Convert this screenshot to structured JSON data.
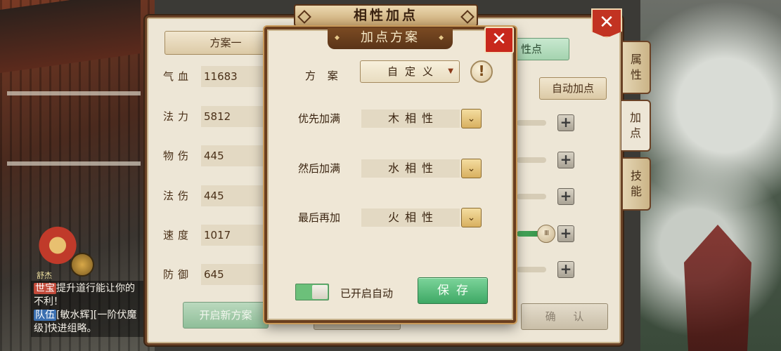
{
  "window": {
    "title": "相性加点",
    "close_label": "✕"
  },
  "left_panel": {
    "scheme_button": "方案一",
    "stats": [
      {
        "label": "气血",
        "value": "11683"
      },
      {
        "label": "法力",
        "value": "5812"
      },
      {
        "label": "物伤",
        "value": "445"
      },
      {
        "label": "法伤",
        "value": "445"
      },
      {
        "label": "速度",
        "value": "1017"
      },
      {
        "label": "防御",
        "value": "645"
      }
    ],
    "new_scheme_button": "开启新方案"
  },
  "right_panel": {
    "partial_tab_label": "性点",
    "auto_add_button": "自动加点",
    "plus_label": "+",
    "slider_knob": "III",
    "confirm_button": "确 认"
  },
  "side_tabs": [
    {
      "label": "属\n性",
      "active": false
    },
    {
      "label": "加\n点",
      "active": true
    },
    {
      "label": "技\n能",
      "active": false
    }
  ],
  "dialog": {
    "title": "加点方案",
    "close_label": "✕",
    "scheme_label": "方 案",
    "scheme_value": "自定义",
    "scheme_arrow": "▼",
    "info_icon": "!",
    "priority": [
      {
        "label": "优先加满",
        "value": "木相性"
      },
      {
        "label": "然后加满",
        "value": "水相性"
      },
      {
        "label": "最后再加",
        "value": "火相性"
      }
    ],
    "dropdown_icon": "⌄",
    "auto_toggle_on": true,
    "auto_label": "已开启自动",
    "save_button": "保存"
  },
  "chat": {
    "line1_tag": "世宝",
    "line1_text": "提升道行能让你的",
    "line2_text": "不利！",
    "line3_tag": "队伍",
    "line3_text": "[敏水辉][一阶伏魔",
    "line4_text": "级]快进组略。",
    "npc_name": "舒杰"
  },
  "colors": {
    "panel_bg": "#ede6d6",
    "frame_brown": "#6a4226",
    "close_red": "#c8281c",
    "save_green": "#3ea865",
    "toggle_green": "#6cc07a"
  }
}
